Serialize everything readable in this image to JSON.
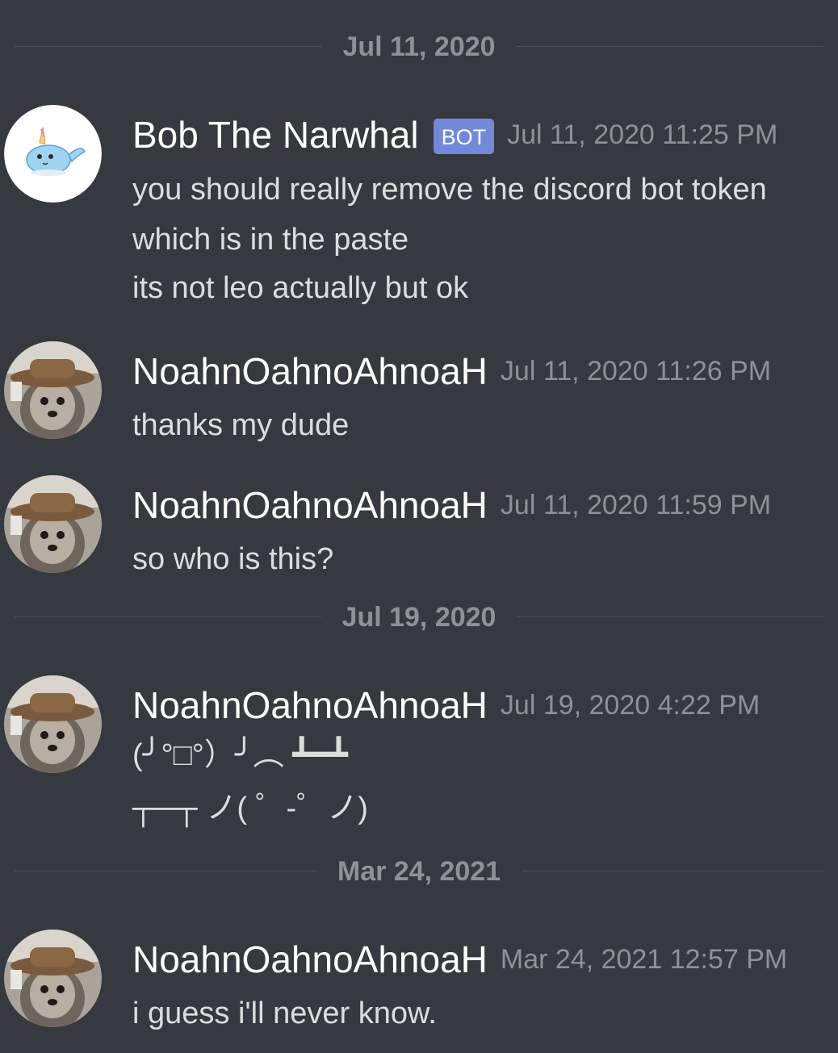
{
  "dividers": [
    "Jul 11, 2020",
    "Jul 19, 2020",
    "Mar 24, 2021"
  ],
  "messages": [
    {
      "author": "Bob The Narwhal",
      "tag": "BOT",
      "timestamp": "Jul 11, 2020 11:25 PM",
      "lines": [
        "you should really remove the discord bot token",
        "which is in the paste",
        "its not leo actually but ok"
      ]
    },
    {
      "author": "NoahnOahnoAhnoaH",
      "timestamp": "Jul 11, 2020 11:26 PM",
      "lines": [
        "thanks my dude"
      ]
    },
    {
      "author": "NoahnOahnoAhnoaH",
      "timestamp": "Jul 11, 2020 11:59 PM",
      "lines": [
        "so who is this?"
      ]
    },
    {
      "author": "NoahnOahnoAhnoaH",
      "timestamp": "Jul 19, 2020 4:22 PM",
      "lines": [
        "(╯°□°）╯︵ ┻━┻",
        "┬─┬ ノ( ゜-゜ノ)"
      ]
    },
    {
      "author": "NoahnOahnoAhnoaH",
      "timestamp": "Mar 24, 2021 12:57 PM",
      "lines": [
        "i guess i'll never know."
      ]
    }
  ],
  "colors": {
    "background": "#36393f",
    "bot_tag": "#7289da",
    "muted": "#8e9297",
    "text": "#dcddde"
  },
  "icons": {
    "bot_avatar": "narwhal-avatar-icon",
    "user_avatar": "dog-with-hat-avatar"
  }
}
